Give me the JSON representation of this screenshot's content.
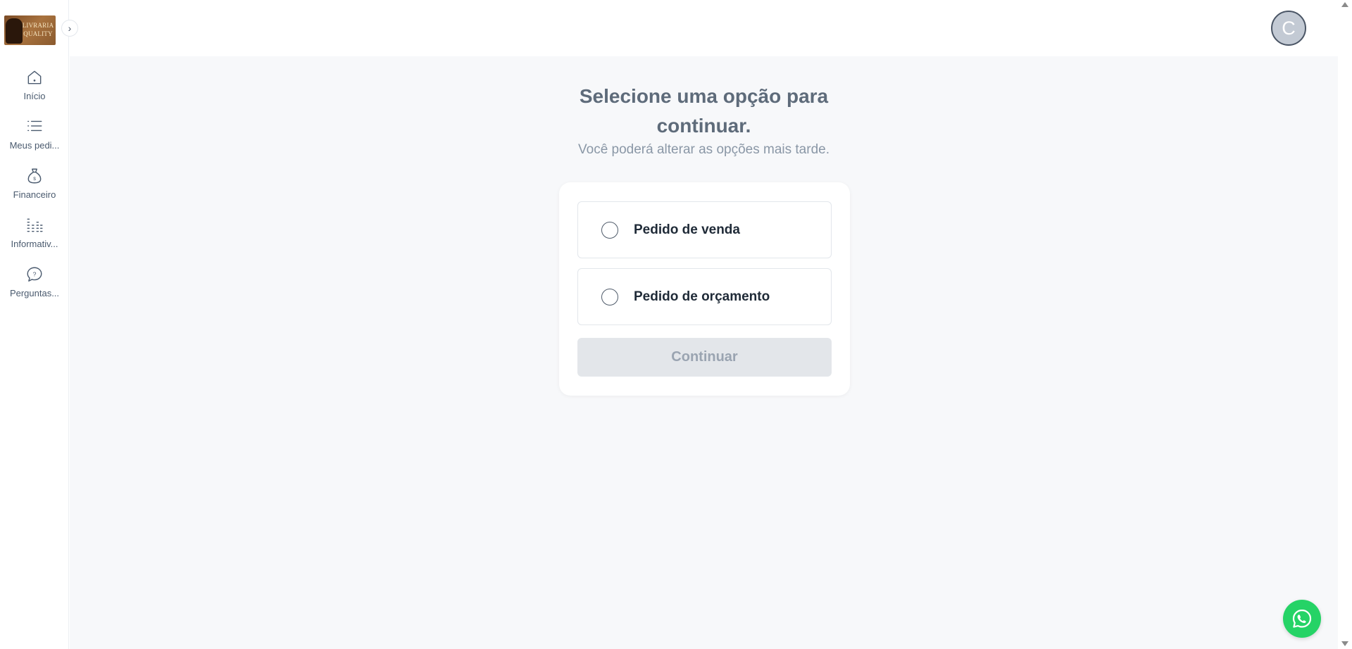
{
  "brand": {
    "logo_text_line1": "LIVRARIA",
    "logo_text_line2": "QUALITY"
  },
  "sidebar": {
    "items": [
      {
        "label": "Início",
        "icon": "home-icon"
      },
      {
        "label": "Meus pedi...",
        "icon": "list-icon"
      },
      {
        "label": "Financeiro",
        "icon": "money-bag-icon"
      },
      {
        "label": "Informativ...",
        "icon": "bars-icon"
      },
      {
        "label": "Perguntas...",
        "icon": "question-icon"
      }
    ],
    "collapse_icon": "chevron-right-icon"
  },
  "header": {
    "avatar_initial": "C"
  },
  "main": {
    "title_line1": "Selecione uma opção para",
    "title_line2": "continuar.",
    "subtitle": "Você poderá alterar as opções mais tarde.",
    "options": [
      {
        "label": "Pedido de venda",
        "selected": false
      },
      {
        "label": "Pedido de orçamento",
        "selected": false
      }
    ],
    "continue_label": "Continuar"
  },
  "colors": {
    "main_bg": "#f7f8fa",
    "title": "#5e6b7a",
    "subtitle": "#8a97a6",
    "button_disabled_bg": "#e3e6ea",
    "button_disabled_text": "#9aa4b1",
    "whatsapp": "#25d366"
  }
}
